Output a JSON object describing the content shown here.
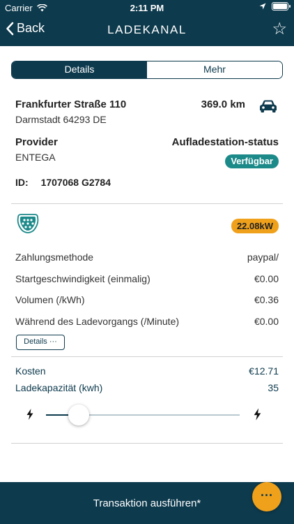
{
  "status_bar": {
    "carrier": "Carrier",
    "time": "2:11 PM"
  },
  "nav": {
    "back_label": "Back",
    "title": "LADEKANAL"
  },
  "tabs": [
    {
      "label": "Details",
      "active": true
    },
    {
      "label": "Mehr",
      "active": false
    }
  ],
  "station": {
    "address_line1": "Frankfurter Straße 110",
    "address_line2": "Darmstadt 64293 DE",
    "distance": "369.0 km",
    "provider_label": "Provider",
    "provider_value": "ENTEGA",
    "status_label": "Aufladestation-status",
    "status_value": "Verfügbar",
    "id_label": "ID:",
    "id_value": "1707068 G2784"
  },
  "connector": {
    "power": "22.08kW",
    "rows": [
      {
        "label": "Zahlungsmethode",
        "value": "paypal/"
      },
      {
        "label": "Startgeschwindigkeit (einmalig)",
        "value": "€0.00"
      },
      {
        "label": "Volumen (/kWh)",
        "value": "€0.36"
      },
      {
        "label": "Während des Ladevorgangs (/Minute)",
        "value": "€0.00"
      }
    ],
    "details_button": "Details ···"
  },
  "cost": {
    "cost_label": "Kosten",
    "cost_value": "€12.71",
    "capacity_label": "Ladekapazität (kwh)",
    "capacity_value": "35"
  },
  "slider": {
    "value_fraction": 0.17
  },
  "bottom": {
    "action_label": "Transaktion ausführen*",
    "fab_label": "···"
  },
  "colors": {
    "primary": "#0d3a4d",
    "available_badge": "#1d8a8a",
    "power_badge": "#f0a11b"
  }
}
